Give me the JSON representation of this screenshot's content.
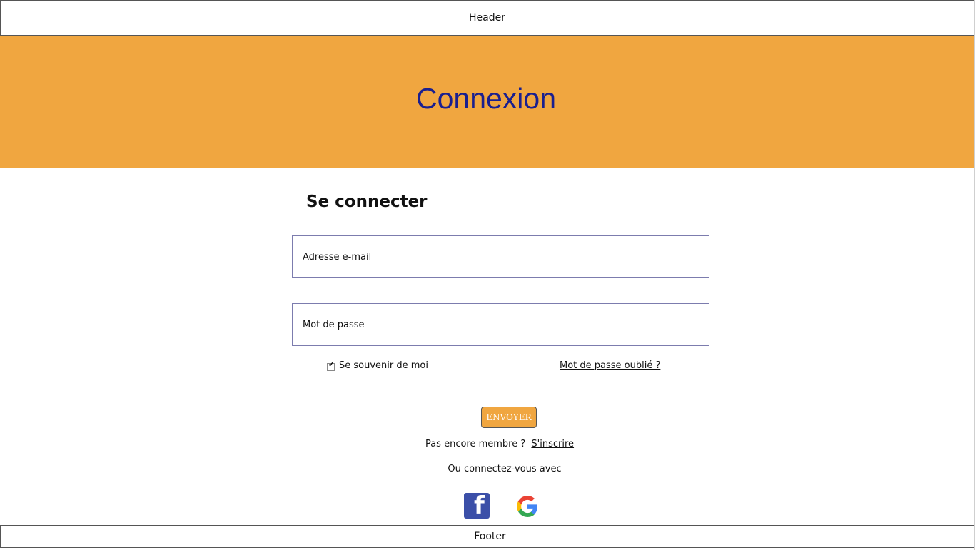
{
  "header": {
    "label": "Header"
  },
  "banner": {
    "title": "Connexion",
    "background": "#f0a640",
    "title_color": "#1a1f8f"
  },
  "form": {
    "title": "Se connecter",
    "email_placeholder": "Adresse e-mail",
    "password_placeholder": "Mot de passe",
    "remember_label": "Se souvenir de moi",
    "remember_checked": true,
    "forgot_link": "Mot de passe oublié ?",
    "submit_label": "ENVOYER"
  },
  "signup": {
    "prompt": "Pas encore membre ?",
    "link": "S'inscrire"
  },
  "social": {
    "prompt": "Ou connectez-vous avec",
    "buttons": [
      {
        "icon": "facebook-icon",
        "glyph": "f",
        "color": "#3b4fa8"
      },
      {
        "icon": "google-icon"
      }
    ]
  },
  "footer": {
    "label": "Footer"
  }
}
